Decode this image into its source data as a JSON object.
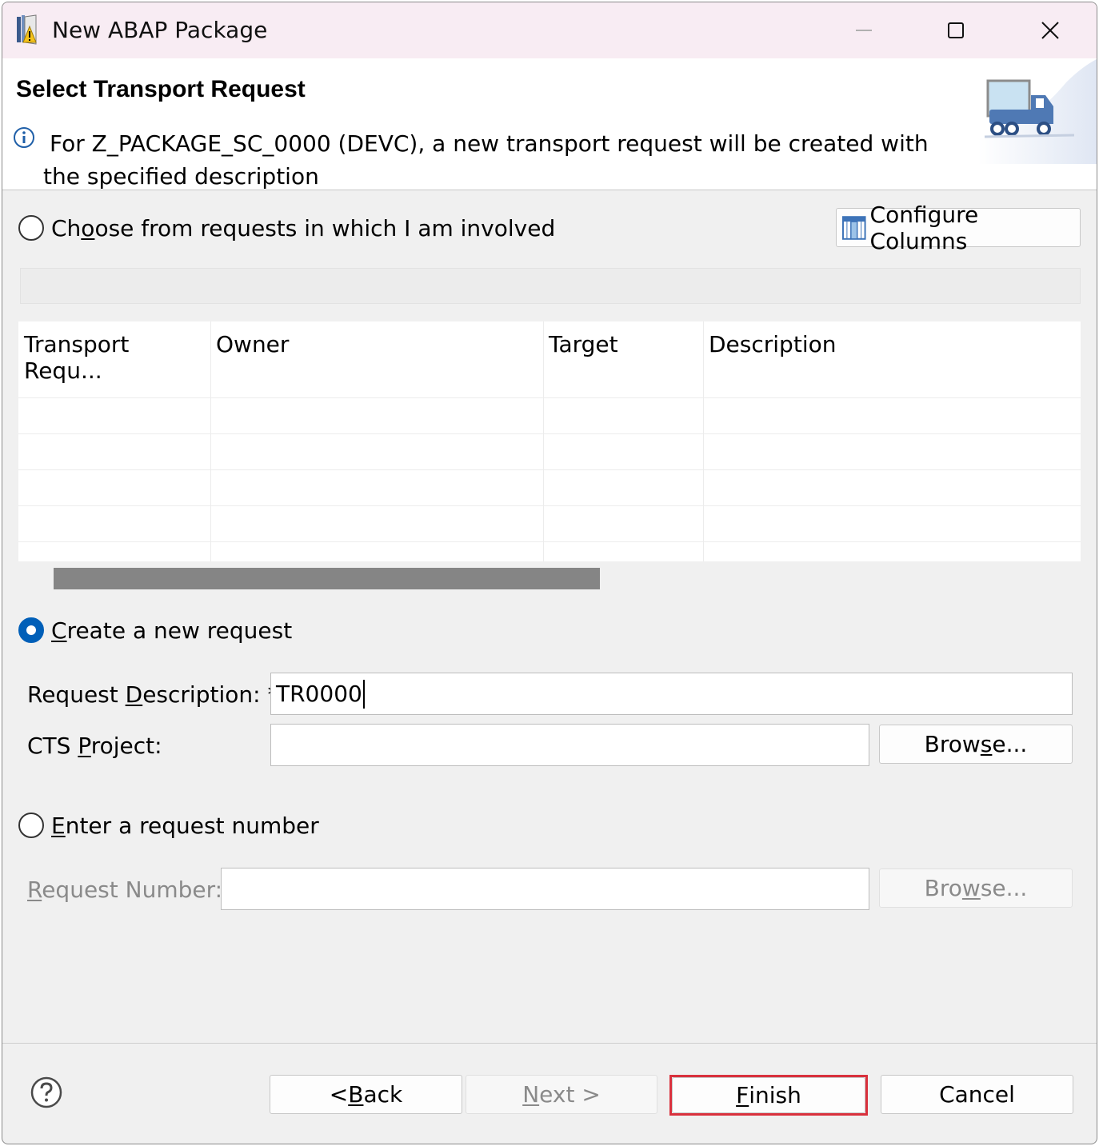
{
  "window": {
    "title": "New ABAP Package"
  },
  "header": {
    "title": "Select Transport Request",
    "message": "For Z_PACKAGE_SC_0000 (DEVC), a new transport request will be created with the specified description"
  },
  "options": {
    "choose": {
      "label_pre": "Ch",
      "label_mnemonic": "o",
      "label_post": "ose from requests in which I am involved",
      "selected": false
    },
    "configure_columns_label": "Configure Columns",
    "create": {
      "label_mnemonic": "C",
      "label_post": "reate a new request",
      "selected": true
    },
    "enter": {
      "label_mnemonic": "E",
      "label_post": "nter a request number",
      "selected": false
    }
  },
  "table": {
    "columns": [
      "Transport Requ...",
      "Owner",
      "Target",
      "Description"
    ],
    "rows": []
  },
  "create_form": {
    "request_description_label_pre": "Request ",
    "request_description_label_mnemonic": "D",
    "request_description_label_post": "escription: *",
    "request_description_value": "TR0000",
    "cts_project_label_pre": "CTS ",
    "cts_project_label_mnemonic": "P",
    "cts_project_label_post": "roject:",
    "cts_project_value": "",
    "browse_pre": "Brow",
    "browse_mnemonic": "s",
    "browse_post": "e..."
  },
  "enter_form": {
    "request_number_label_mnemonic": "R",
    "request_number_label_post": "equest Number:",
    "request_number_value": "",
    "browse_pre": "Bro",
    "browse_mnemonic": "w",
    "browse_post": "se..."
  },
  "footer": {
    "back_pre": "< ",
    "back_mnemonic": "B",
    "back_post": "ack",
    "next_mnemonic": "N",
    "next_post": "ext >",
    "finish_mnemonic": "F",
    "finish_post": "inish",
    "cancel_label": "Cancel"
  },
  "colors": {
    "accent": "#005fb8",
    "highlight": "#d9313d",
    "titlebar": "#f8ecf3"
  },
  "icons": {
    "app": "abap-package-icon",
    "info": "info-icon",
    "header_graphic": "transport-truck-icon",
    "configure_columns": "columns-icon",
    "help": "help-icon"
  }
}
